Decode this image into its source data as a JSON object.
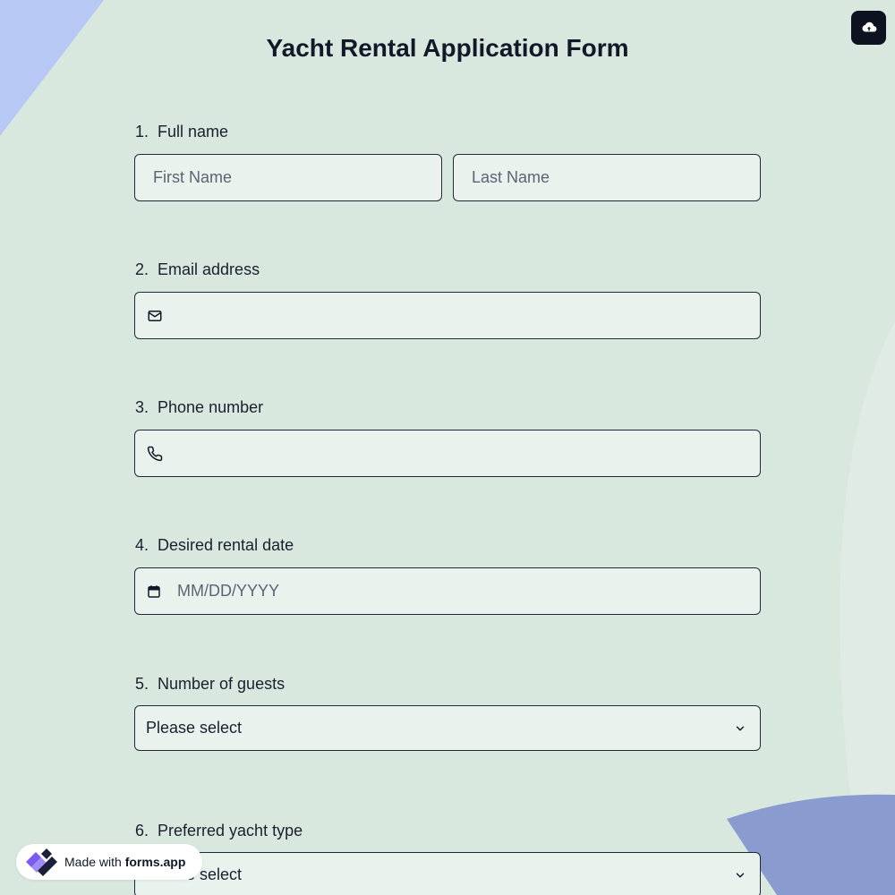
{
  "form": {
    "title": "Yacht Rental Application Form"
  },
  "questions": [
    {
      "number": "1.",
      "label": "Full name"
    },
    {
      "number": "2.",
      "label": "Email address"
    },
    {
      "number": "3.",
      "label": "Phone number"
    },
    {
      "number": "4.",
      "label": "Desired rental date"
    },
    {
      "number": "5.",
      "label": "Number of guests"
    },
    {
      "number": "6.",
      "label": "Preferred yacht type"
    }
  ],
  "fields": {
    "first_name": {
      "placeholder": "First Name",
      "value": ""
    },
    "last_name": {
      "placeholder": "Last Name",
      "value": ""
    },
    "email": {
      "placeholder": "",
      "value": ""
    },
    "phone": {
      "placeholder": "",
      "value": ""
    },
    "date": {
      "placeholder": "MM/DD/YYYY",
      "value": ""
    },
    "guests": {
      "selected": "Please select"
    },
    "yacht_type": {
      "selected": "Please select"
    }
  },
  "badge": {
    "prefix": "Made with",
    "brand": "forms.app"
  },
  "icons": {
    "upload": "cloud-upload-icon",
    "email": "mail-icon",
    "phone": "phone-icon",
    "date": "calendar-icon",
    "select": "chevron-down-icon",
    "logo": "forms-app-logo-icon"
  },
  "colors": {
    "background": "#d9e8df",
    "field_background": "#e9f2ec",
    "border": "#1f2937",
    "accent_light_blue": "#b6c8f3",
    "accent_periwinkle": "#8a9ccf",
    "button_dark": "#0d1220",
    "logo_purple": "#7c5cf0"
  }
}
